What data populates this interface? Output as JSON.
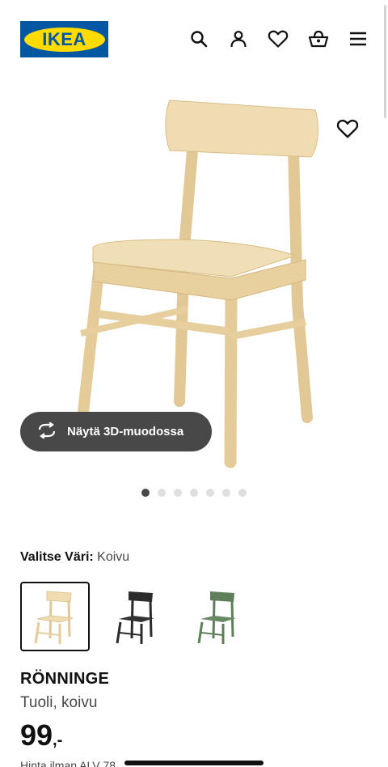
{
  "header": {
    "logo_text": "IKEA",
    "icons": [
      "search-icon",
      "account-icon",
      "favourites-icon",
      "basket-icon",
      "menu-icon"
    ],
    "brand_blue": "#0058a3",
    "brand_yellow": "#ffdb00"
  },
  "gallery": {
    "button_3d_label": "Näytä 3D-muodossa",
    "image_count": 7,
    "active_index": 0
  },
  "variant": {
    "label": "Valitse Väri:",
    "value": "Koivu",
    "options": [
      {
        "name": "Koivu",
        "color": "#ead7ad",
        "selected": true
      },
      {
        "name": "musta",
        "color": "#2b2b2b",
        "selected": false
      },
      {
        "name": "vihreä",
        "color": "#5e7f5a",
        "selected": false
      }
    ]
  },
  "product": {
    "name": "RÖNNINGE",
    "description": "Tuoli, koivu",
    "price_integer": "99",
    "price_suffix": ",-",
    "vat_note": "Hinta ilman ALV 78"
  }
}
